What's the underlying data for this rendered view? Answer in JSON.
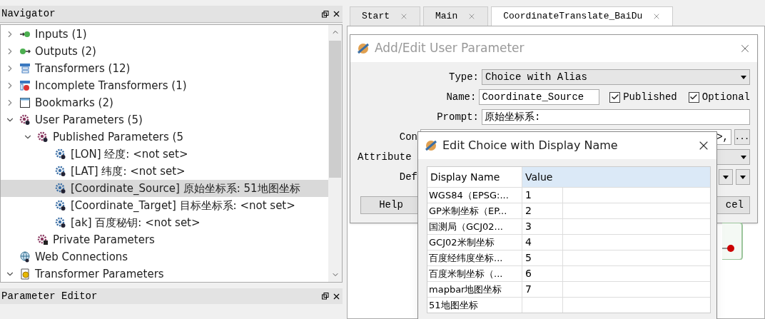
{
  "navigator": {
    "title": "Navigator",
    "items": [
      {
        "label": "Inputs (1)",
        "kind": "input",
        "expanded": false,
        "selected": false
      },
      {
        "label": "Outputs (2)",
        "kind": "output",
        "expanded": false,
        "selected": false
      },
      {
        "label": "Transformers (12)",
        "kind": "transformer",
        "expanded": false,
        "selected": false
      },
      {
        "label": "Incomplete Transformers (1)",
        "kind": "incomplete",
        "expanded": false,
        "selected": false
      },
      {
        "label": "Bookmarks (2)",
        "kind": "bookmark",
        "expanded": false,
        "selected": false
      },
      {
        "label": "User Parameters (5)",
        "kind": "user",
        "expanded": true,
        "selected": false,
        "children": [
          {
            "label": "Published Parameters (5",
            "kind": "user",
            "expanded": true,
            "selected": false,
            "children": [
              {
                "label": "[LON] 经度: <not set>",
                "kind": "param",
                "selected": false
              },
              {
                "label": "[LAT] 纬度: <not set>",
                "kind": "param",
                "selected": false
              },
              {
                "label": "[Coordinate_Source] 原始坐标系: 51地图坐标",
                "kind": "param",
                "selected": true
              },
              {
                "label": "[Coordinate_Target] 目标坐标系: <not set>",
                "kind": "param",
                "selected": false
              },
              {
                "label": "[ak] 百度秘钥: <not set>",
                "kind": "param",
                "selected": false
              }
            ]
          },
          {
            "label": "Private Parameters",
            "kind": "private",
            "selected": false
          }
        ]
      },
      {
        "label": "Web Connections",
        "kind": "web",
        "selected": false
      },
      {
        "label": "Transformer Parameters",
        "kind": "tparam",
        "expanded": true,
        "selected": false
      }
    ]
  },
  "parameter_editor": {
    "title": "Parameter Editor"
  },
  "tabs": [
    {
      "label": "Start",
      "selected": false
    },
    {
      "label": "Main",
      "selected": false
    },
    {
      "label": "CoordinateTranslate_BaiDu",
      "selected": true
    }
  ],
  "parameter_dialog": {
    "title": "Add/Edit User Parameter",
    "type_label": "Type:",
    "type_value": "Choice with Alias",
    "name_label": "Name:",
    "name_value": "Coordinate_Source",
    "published": {
      "label": "Published",
      "checked": true
    },
    "optional": {
      "label": "Optional",
      "checked": true
    },
    "prompt_label": "Prompt:",
    "prompt_value": "原始坐标系:",
    "config_label": "Con",
    "config_tail": ">,",
    "config_button": "...",
    "attribute_label": "Attribute ",
    "default_label": "Def",
    "help_button": "Help",
    "cancel_button": "cel"
  },
  "choice_dialog": {
    "title": "Edit Choice with Display Name",
    "columns": [
      "Display Name",
      "Value"
    ],
    "rows": [
      [
        "WGS84（EPSG:...",
        "1"
      ],
      [
        "GP米制坐标（EP...",
        "2"
      ],
      [
        "国测局（GCJ02...",
        "3"
      ],
      [
        "GCJ02米制坐标",
        "4"
      ],
      [
        "百度经纬度坐标...",
        "5"
      ],
      [
        "百度米制坐标（...",
        "6"
      ],
      [
        "mapbar地图坐标",
        "7"
      ],
      [
        "51地图坐标",
        ""
      ]
    ]
  }
}
